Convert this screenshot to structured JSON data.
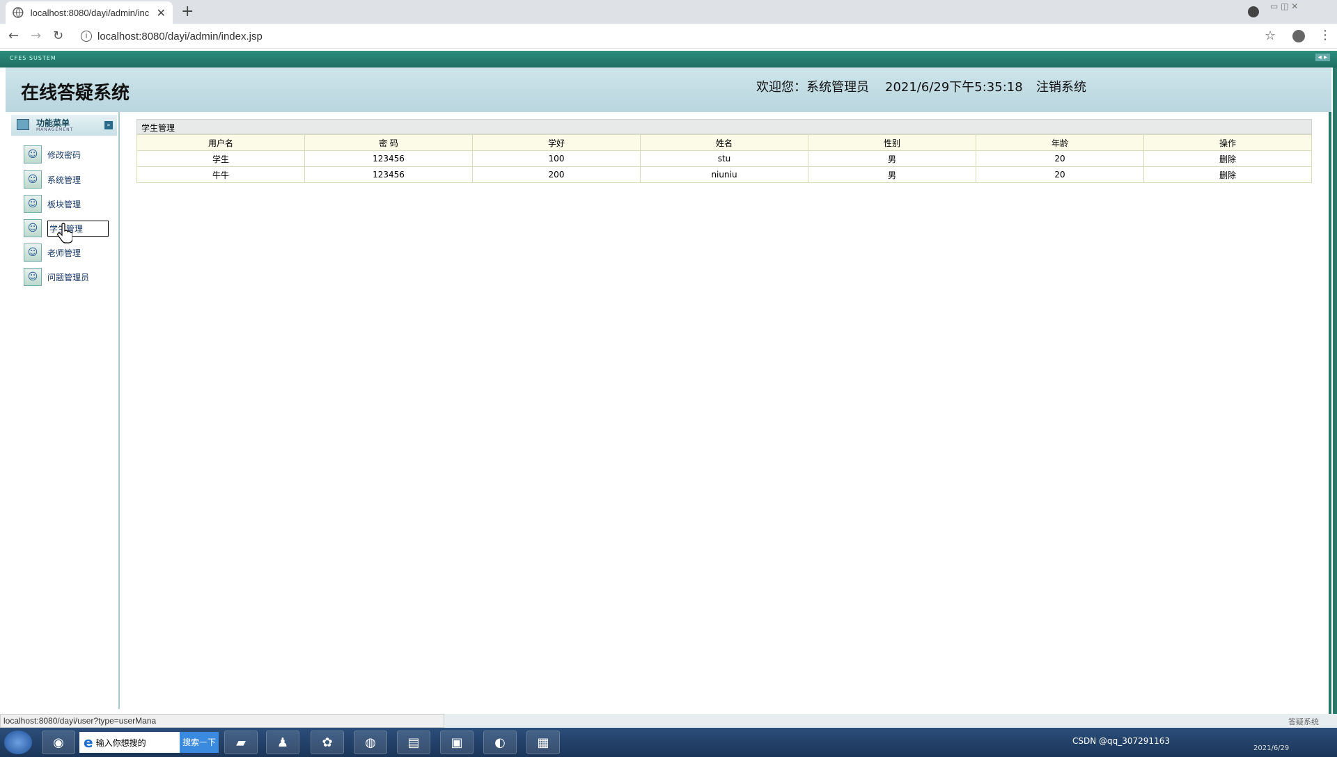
{
  "browser": {
    "tab_title": "localhost:8080/dayi/admin/inc",
    "url": "localhost:8080/dayi/admin/index.jsp",
    "new_tab": "+",
    "close": "✕",
    "back": "←",
    "forward": "→",
    "reload": "↻",
    "info": "i",
    "star": "☆",
    "menu": "⋮",
    "window_controls": "▭ ◫ ✕"
  },
  "frame": {
    "system_tag": "CFES SUSTEM",
    "frame_arrows": "◂ ▸"
  },
  "header": {
    "title": "在线答疑系统",
    "welcome": "欢迎您：系统管理员",
    "datetime": "2021/6/29下午5:35:18",
    "logout": "注销系统"
  },
  "sidebar": {
    "menu_title": "功能菜单",
    "menu_subtitle": "MANAGEMENT",
    "toggle": "»",
    "items": [
      {
        "label": "修改密码"
      },
      {
        "label": "系统管理"
      },
      {
        "label": "板块管理"
      },
      {
        "label": "学生管理"
      },
      {
        "label": "老师管理"
      },
      {
        "label": "问题管理员"
      }
    ]
  },
  "panel": {
    "title": "学生管理",
    "columns": [
      "用户名",
      "密 码",
      "学好",
      "姓名",
      "性别",
      "年龄",
      "操作"
    ],
    "rows": [
      [
        "学生",
        "123456",
        "100",
        "stu",
        "男",
        "20",
        "删除"
      ],
      [
        "牛牛",
        "123456",
        "200",
        "niuniu",
        "男",
        "20",
        "删除"
      ]
    ]
  },
  "status_bar": {
    "url": "localhost:8080/dayi/user?type=userMana",
    "footer_text": "答疑系统"
  },
  "taskbar": {
    "search_placeholder": "输入你想搜的",
    "search_button": "搜索一下",
    "tray_text": "CSDN @qq_307291163",
    "tray_date": "2021/6/29"
  },
  "colors": {
    "frame_green": "#1e6e62",
    "header_blue": "#b9d5de",
    "table_border": "#d8dcb8",
    "menu_text": "#1a3a6a"
  }
}
